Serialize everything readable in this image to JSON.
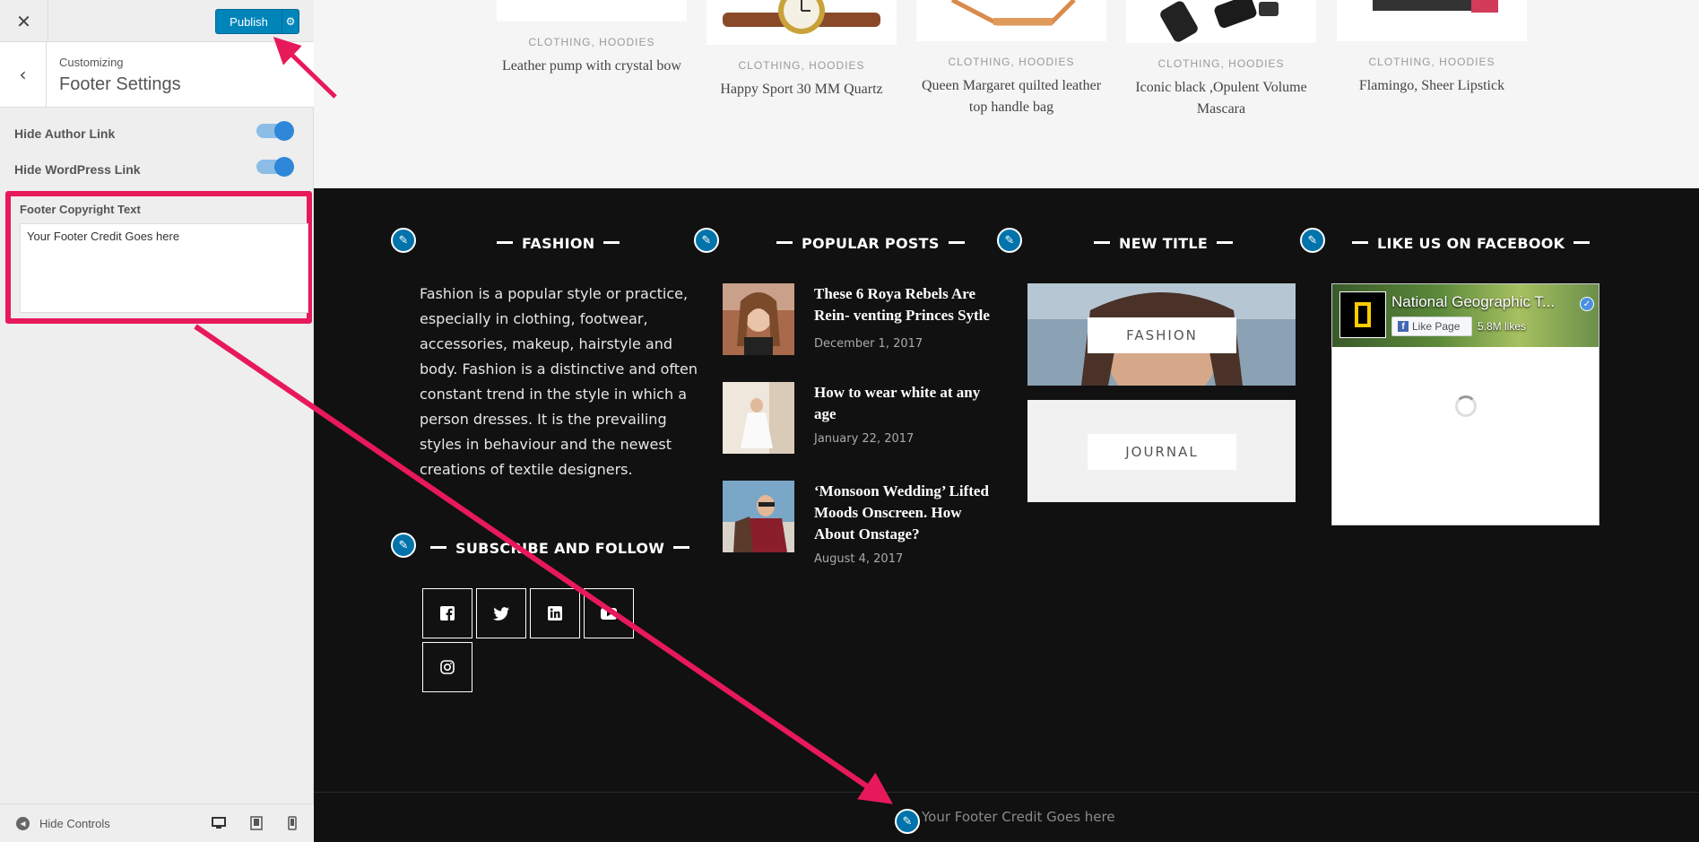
{
  "sidebar": {
    "close_icon": "close-icon",
    "publish_label": "Publish",
    "customizing_label": "Customizing",
    "section_title": "Footer Settings",
    "toggles": [
      {
        "label": "Hide Author Link",
        "on": true
      },
      {
        "label": "Hide WordPress Link",
        "on": true
      }
    ],
    "copyright": {
      "label": "Footer Copyright Text",
      "value": "Your Footer Credit Goes here"
    },
    "footer": {
      "hide_controls_label": "Hide Controls"
    }
  },
  "products": [
    {
      "category": "CLOTHING, HOODIES",
      "name": "Leather pump with crystal bow"
    },
    {
      "category": "CLOTHING, HOODIES",
      "name": "Happy Sport 30 MM Quartz"
    },
    {
      "category": "CLOTHING, HOODIES",
      "name": "Queen Margaret quilted leather top handle bag"
    },
    {
      "category": "CLOTHING, HOODIES",
      "name": "Iconic black ,Opulent Volume Mascara"
    },
    {
      "category": "CLOTHING, HOODIES",
      "name": "Flamingo, Sheer Lipstick"
    }
  ],
  "footer": {
    "fashion": {
      "title": "FASHION",
      "text": "Fashion is a popular style or practice, especially in clothing, footwear, accessories, makeup, hairstyle and body. Fashion is a distinctive and often constant trend in the style in which a person dresses. It is the prevailing styles in behaviour and the newest creations of textile designers."
    },
    "subscribe": {
      "title": "SUBSCRIBE AND FOLLOW"
    },
    "popular": {
      "title": "POPULAR POSTS",
      "posts": [
        {
          "title": "These 6 Roya Rebels Are Rein- venting Princes Sytle",
          "date": "December 1, 2017"
        },
        {
          "title": "How to wear white at any age",
          "date": "January 22, 2017"
        },
        {
          "title": "‘Monsoon Wedding’ Lifted Moods Onscreen. How About Onstage?",
          "date": "August 4, 2017"
        }
      ]
    },
    "new_title": {
      "title": "NEW TITLE",
      "categories": [
        "FASHION",
        "JOURNAL"
      ]
    },
    "facebook": {
      "title": "LIKE US ON FACEBOOK",
      "page_name": "National Geographic T...",
      "like_label": "Like Page",
      "likes": "5.8M likes"
    },
    "copyright_text": "Your Footer Credit Goes here"
  },
  "colors": {
    "accent_publish": "#0085ba",
    "highlight": "#e8195a",
    "footer_bg": "#111111",
    "edit_icon": "#0073aa"
  }
}
